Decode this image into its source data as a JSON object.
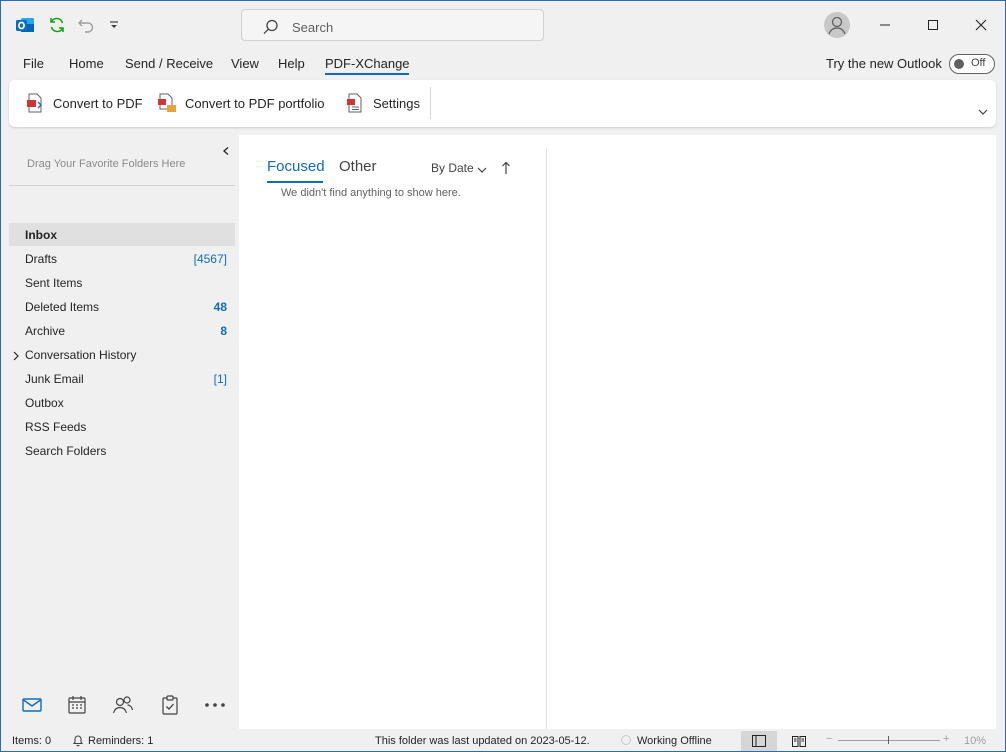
{
  "titlebar": {
    "search_placeholder": "Search"
  },
  "menu": {
    "items": [
      "File",
      "Home",
      "Send / Receive",
      "View",
      "Help",
      "PDF-XChange"
    ],
    "active": "PDF-XChange",
    "try_new": "Try the new Outlook",
    "toggle_state": "Off"
  },
  "ribbon": {
    "convert_pdf": "Convert to PDF",
    "convert_portfolio": "Convert to PDF portfolio",
    "settings": "Settings"
  },
  "folders": {
    "favorites_hint": "Drag Your Favorite Folders Here",
    "items": [
      {
        "name": "Inbox",
        "count": "",
        "selected": true
      },
      {
        "name": "Drafts",
        "count": "[4567]"
      },
      {
        "name": "Sent Items",
        "count": ""
      },
      {
        "name": "Deleted Items",
        "count": "48"
      },
      {
        "name": "Archive",
        "count": "8"
      },
      {
        "name": "Conversation History",
        "count": ""
      },
      {
        "name": "Junk Email",
        "count": "[1]"
      },
      {
        "name": "Outbox",
        "count": ""
      },
      {
        "name": "RSS Feeds",
        "count": ""
      },
      {
        "name": "Search Folders",
        "count": ""
      }
    ]
  },
  "message_list": {
    "tab_focused": "Focused",
    "tab_other": "Other",
    "sort_by": "By Date",
    "empty_message": "We didn't find anything to show here."
  },
  "statusbar": {
    "items": "Items: 0",
    "reminders": "Reminders: 1",
    "last_updated": "This folder was last updated on 2023-05-12.",
    "offline": "Working Offline",
    "zoom": "10%"
  },
  "colors": {
    "accent": "#0f6cbd",
    "window_border": "#2b6cb0"
  }
}
